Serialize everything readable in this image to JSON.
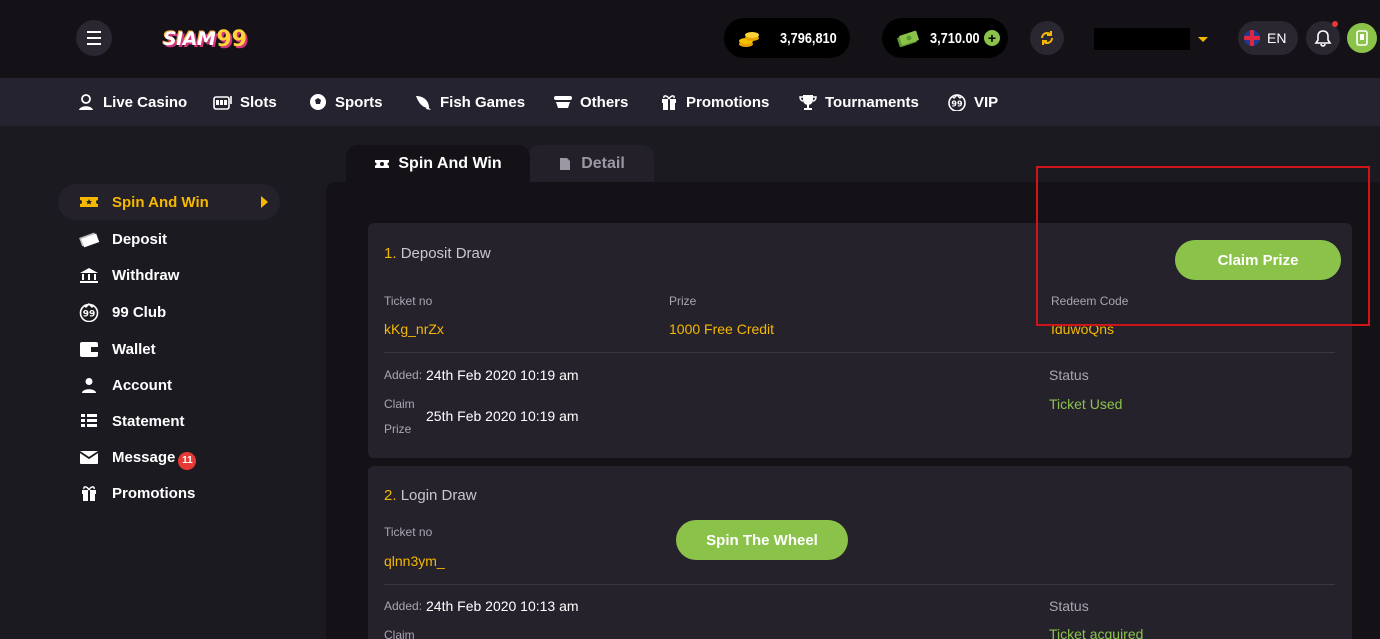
{
  "header": {
    "logo_text_1": "SIAM",
    "logo_text_2": "99",
    "gold_balance": "3,796,810",
    "cash_balance": "3,710.00",
    "language": "EN"
  },
  "nav": [
    {
      "label": "Live Casino",
      "icon": "dealer-icon"
    },
    {
      "label": "Slots",
      "icon": "slot-machine-icon"
    },
    {
      "label": "Sports",
      "icon": "soccer-ball-icon"
    },
    {
      "label": "Fish Games",
      "icon": "fish-icon"
    },
    {
      "label": "Others",
      "icon": "stack-icon"
    },
    {
      "label": "Promotions",
      "icon": "gift-icon"
    },
    {
      "label": "Tournaments",
      "icon": "trophy-icon"
    },
    {
      "label": "VIP",
      "icon": "vip-99-icon"
    }
  ],
  "sidebar": [
    {
      "label": "Spin And Win",
      "icon": "ticket-icon",
      "active": true
    },
    {
      "label": "Deposit",
      "icon": "cash-icon"
    },
    {
      "label": "Withdraw",
      "icon": "bank-icon"
    },
    {
      "label": "99 Club",
      "icon": "club-99-icon"
    },
    {
      "label": "Wallet",
      "icon": "wallet-icon"
    },
    {
      "label": "Account",
      "icon": "user-icon"
    },
    {
      "label": "Statement",
      "icon": "list-icon"
    },
    {
      "label": "Message",
      "icon": "envelope-icon",
      "badge": "11"
    },
    {
      "label": "Promotions",
      "icon": "gift-icon"
    }
  ],
  "tabs": [
    {
      "label": "Spin And Win",
      "icon": "ticket-icon",
      "active": true
    },
    {
      "label": "Detail",
      "icon": "document-icon",
      "active": false
    }
  ],
  "draws": [
    {
      "num": "1.",
      "title": "Deposit Draw",
      "ticket_label": "Ticket no",
      "ticket": "kKg_nrZx",
      "prize_label": "Prize",
      "prize": "1000 Free Credit",
      "redeem_label": "Redeem Code",
      "redeem": "IduwoQns",
      "added_label": "Added:",
      "added": "24th Feb 2020 10:19 am",
      "claim_label_1": "Claim",
      "claim_label_2": "Prize",
      "claim": "25th Feb 2020 10:19 am",
      "status_label": "Status",
      "status": "Ticket Used",
      "button": "Claim Prize"
    },
    {
      "num": "2.",
      "title": "Login Draw",
      "ticket_label": "Ticket no",
      "ticket": "qlnn3ym_",
      "added_label": "Added:",
      "added": "24th Feb 2020 10:13 am",
      "claim_label_1": "Claim",
      "status_label": "Status",
      "status": "Ticket acquired",
      "button": "Spin The Wheel"
    }
  ],
  "colors": {
    "accent_yellow": "#f5b800",
    "accent_green": "#8bc34a",
    "highlight_box": "#d0141a"
  }
}
